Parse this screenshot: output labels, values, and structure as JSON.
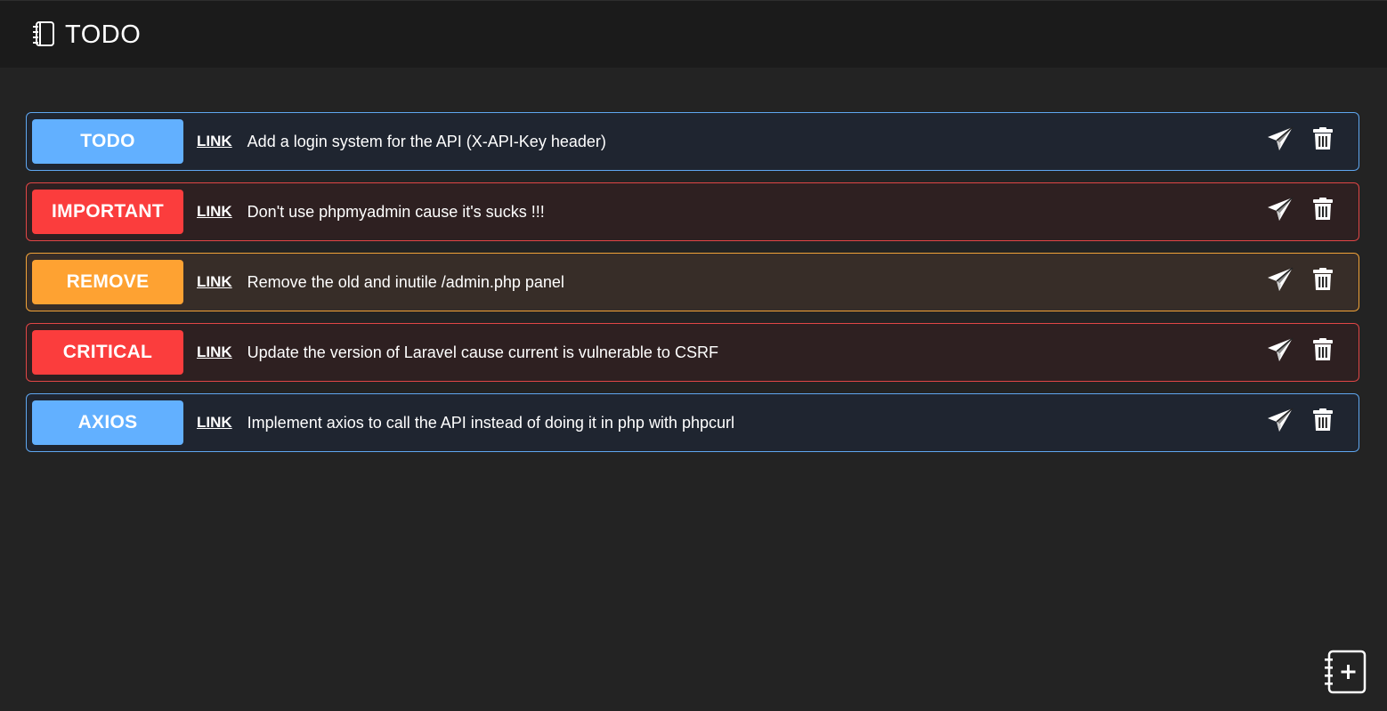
{
  "header": {
    "title": "TODO",
    "icon": "notebook-icon"
  },
  "todos": [
    {
      "tag": "TODO",
      "link": "LINK",
      "text": "Add a login system for the API (X-API-Key header)",
      "tag_color": "#62b0ff",
      "border_color": "#5fa7f0",
      "bg_color": "#1f2530"
    },
    {
      "tag": "IMPORTANT",
      "link": "LINK",
      "text": "Don't use phpmyadmin cause it's sucks !!!",
      "tag_color": "#fb3d3d",
      "border_color": "#e04646",
      "bg_color": "#2e2021"
    },
    {
      "tag": "REMOVE",
      "link": "LINK",
      "text": "Remove the old and inutile /admin.php panel",
      "tag_color": "#fea232",
      "border_color": "#f0a238",
      "bg_color": "#372d28"
    },
    {
      "tag": "CRITICAL",
      "link": "LINK",
      "text": "Update the version of Laravel cause current is vulnerable to CSRF",
      "tag_color": "#fb3d3d",
      "border_color": "#e04646",
      "bg_color": "#2e2021"
    },
    {
      "tag": "AXIOS",
      "link": "LINK",
      "text": "Implement axios to call the API instead of doing it in php with phpcurl",
      "tag_color": "#62b0ff",
      "border_color": "#5fa7f0",
      "bg_color": "#1f2530"
    }
  ],
  "icons": {
    "send": "paper-plane-icon",
    "delete": "trash-icon",
    "add": "add-note-icon"
  }
}
